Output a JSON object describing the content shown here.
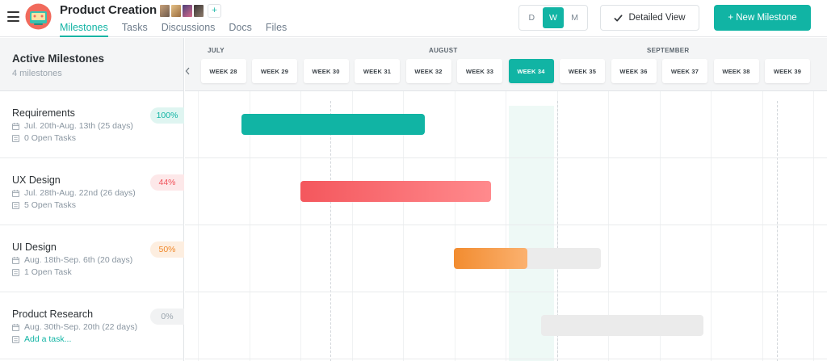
{
  "app": {
    "project_title": "Product Creation",
    "add_member_icon": "add-person-icon"
  },
  "tabs": [
    {
      "label": "Milestones",
      "active": true
    },
    {
      "label": "Tasks",
      "active": false
    },
    {
      "label": "Discussions",
      "active": false
    },
    {
      "label": "Docs",
      "active": false
    },
    {
      "label": "Files",
      "active": false
    }
  ],
  "view_toggle": {
    "options": [
      "D",
      "W",
      "M"
    ],
    "selected": "W"
  },
  "detailed_view_label": "Detailed View",
  "new_milestone_label": "+ New Milestone",
  "left_panel": {
    "title": "Active Milestones",
    "subtitle": "4 milestones"
  },
  "months": [
    "JULY",
    "AUGUST",
    "SEPTEMBER"
  ],
  "weeks": [
    "WEEK 28",
    "WEEK 29",
    "WEEK 30",
    "WEEK 31",
    "WEEK 32",
    "WEEK 33",
    "WEEK 34",
    "WEEK 35",
    "WEEK 36",
    "WEEK 37",
    "WEEK 38",
    "WEEK 39"
  ],
  "current_week": "WEEK 34",
  "milestones": [
    {
      "name": "Requirements",
      "dates": "Jul. 20th-Aug. 13th (25 days)",
      "tasks": "0 Open Tasks",
      "percent": "100%",
      "progress": 1.0,
      "badge_bg": "#dff5f1",
      "badge_color": "#11b4a4",
      "bar_color": "#11b4a4"
    },
    {
      "name": "UX Design",
      "dates": "Jul. 28th-Aug. 22nd (26 days)",
      "tasks": "5 Open Tasks",
      "percent": "44%",
      "progress": 0.44,
      "badge_bg": "#fde8e9",
      "badge_color": "#f0525a",
      "bar_color": "#f4575d"
    },
    {
      "name": "UI Design",
      "dates": "Aug. 18th-Sep. 6th (20 days)",
      "tasks": "1 Open Task",
      "percent": "50%",
      "progress": 0.5,
      "badge_bg": "#fdeee0",
      "badge_color": "#f08a2c",
      "bar_color": "#f28c30"
    },
    {
      "name": "Product Research",
      "dates": "Aug. 30th-Sep. 20th (22 days)",
      "tasks": "Add a task...",
      "percent": "0%",
      "progress": 0,
      "badge_bg": "#f1f2f3",
      "badge_color": "#9aa4ad",
      "bar_color": "#ebebeb"
    }
  ],
  "colors": {
    "accent": "#11b4a4"
  }
}
